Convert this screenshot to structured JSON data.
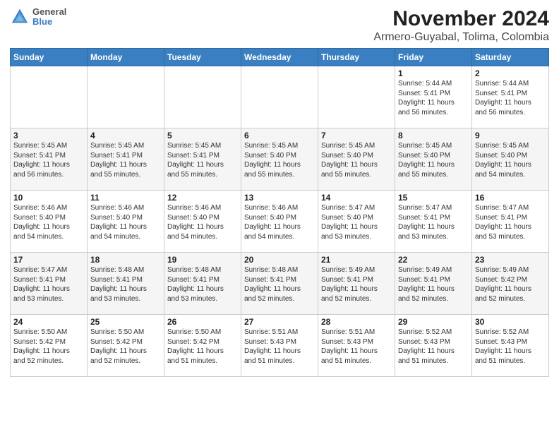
{
  "logo": {
    "line1": "General",
    "line2": "Blue"
  },
  "title": "November 2024",
  "subtitle": "Armero-Guyabal, Tolima, Colombia",
  "days_of_week": [
    "Sunday",
    "Monday",
    "Tuesday",
    "Wednesday",
    "Thursday",
    "Friday",
    "Saturday"
  ],
  "weeks": [
    [
      {
        "day": "",
        "info": ""
      },
      {
        "day": "",
        "info": ""
      },
      {
        "day": "",
        "info": ""
      },
      {
        "day": "",
        "info": ""
      },
      {
        "day": "",
        "info": ""
      },
      {
        "day": "1",
        "info": "Sunrise: 5:44 AM\nSunset: 5:41 PM\nDaylight: 11 hours\nand 56 minutes."
      },
      {
        "day": "2",
        "info": "Sunrise: 5:44 AM\nSunset: 5:41 PM\nDaylight: 11 hours\nand 56 minutes."
      }
    ],
    [
      {
        "day": "3",
        "info": "Sunrise: 5:45 AM\nSunset: 5:41 PM\nDaylight: 11 hours\nand 56 minutes."
      },
      {
        "day": "4",
        "info": "Sunrise: 5:45 AM\nSunset: 5:41 PM\nDaylight: 11 hours\nand 55 minutes."
      },
      {
        "day": "5",
        "info": "Sunrise: 5:45 AM\nSunset: 5:41 PM\nDaylight: 11 hours\nand 55 minutes."
      },
      {
        "day": "6",
        "info": "Sunrise: 5:45 AM\nSunset: 5:40 PM\nDaylight: 11 hours\nand 55 minutes."
      },
      {
        "day": "7",
        "info": "Sunrise: 5:45 AM\nSunset: 5:40 PM\nDaylight: 11 hours\nand 55 minutes."
      },
      {
        "day": "8",
        "info": "Sunrise: 5:45 AM\nSunset: 5:40 PM\nDaylight: 11 hours\nand 55 minutes."
      },
      {
        "day": "9",
        "info": "Sunrise: 5:45 AM\nSunset: 5:40 PM\nDaylight: 11 hours\nand 54 minutes."
      }
    ],
    [
      {
        "day": "10",
        "info": "Sunrise: 5:46 AM\nSunset: 5:40 PM\nDaylight: 11 hours\nand 54 minutes."
      },
      {
        "day": "11",
        "info": "Sunrise: 5:46 AM\nSunset: 5:40 PM\nDaylight: 11 hours\nand 54 minutes."
      },
      {
        "day": "12",
        "info": "Sunrise: 5:46 AM\nSunset: 5:40 PM\nDaylight: 11 hours\nand 54 minutes."
      },
      {
        "day": "13",
        "info": "Sunrise: 5:46 AM\nSunset: 5:40 PM\nDaylight: 11 hours\nand 54 minutes."
      },
      {
        "day": "14",
        "info": "Sunrise: 5:47 AM\nSunset: 5:40 PM\nDaylight: 11 hours\nand 53 minutes."
      },
      {
        "day": "15",
        "info": "Sunrise: 5:47 AM\nSunset: 5:41 PM\nDaylight: 11 hours\nand 53 minutes."
      },
      {
        "day": "16",
        "info": "Sunrise: 5:47 AM\nSunset: 5:41 PM\nDaylight: 11 hours\nand 53 minutes."
      }
    ],
    [
      {
        "day": "17",
        "info": "Sunrise: 5:47 AM\nSunset: 5:41 PM\nDaylight: 11 hours\nand 53 minutes."
      },
      {
        "day": "18",
        "info": "Sunrise: 5:48 AM\nSunset: 5:41 PM\nDaylight: 11 hours\nand 53 minutes."
      },
      {
        "day": "19",
        "info": "Sunrise: 5:48 AM\nSunset: 5:41 PM\nDaylight: 11 hours\nand 53 minutes."
      },
      {
        "day": "20",
        "info": "Sunrise: 5:48 AM\nSunset: 5:41 PM\nDaylight: 11 hours\nand 52 minutes."
      },
      {
        "day": "21",
        "info": "Sunrise: 5:49 AM\nSunset: 5:41 PM\nDaylight: 11 hours\nand 52 minutes."
      },
      {
        "day": "22",
        "info": "Sunrise: 5:49 AM\nSunset: 5:41 PM\nDaylight: 11 hours\nand 52 minutes."
      },
      {
        "day": "23",
        "info": "Sunrise: 5:49 AM\nSunset: 5:42 PM\nDaylight: 11 hours\nand 52 minutes."
      }
    ],
    [
      {
        "day": "24",
        "info": "Sunrise: 5:50 AM\nSunset: 5:42 PM\nDaylight: 11 hours\nand 52 minutes."
      },
      {
        "day": "25",
        "info": "Sunrise: 5:50 AM\nSunset: 5:42 PM\nDaylight: 11 hours\nand 52 minutes."
      },
      {
        "day": "26",
        "info": "Sunrise: 5:50 AM\nSunset: 5:42 PM\nDaylight: 11 hours\nand 51 minutes."
      },
      {
        "day": "27",
        "info": "Sunrise: 5:51 AM\nSunset: 5:43 PM\nDaylight: 11 hours\nand 51 minutes."
      },
      {
        "day": "28",
        "info": "Sunrise: 5:51 AM\nSunset: 5:43 PM\nDaylight: 11 hours\nand 51 minutes."
      },
      {
        "day": "29",
        "info": "Sunrise: 5:52 AM\nSunset: 5:43 PM\nDaylight: 11 hours\nand 51 minutes."
      },
      {
        "day": "30",
        "info": "Sunrise: 5:52 AM\nSunset: 5:43 PM\nDaylight: 11 hours\nand 51 minutes."
      }
    ]
  ]
}
